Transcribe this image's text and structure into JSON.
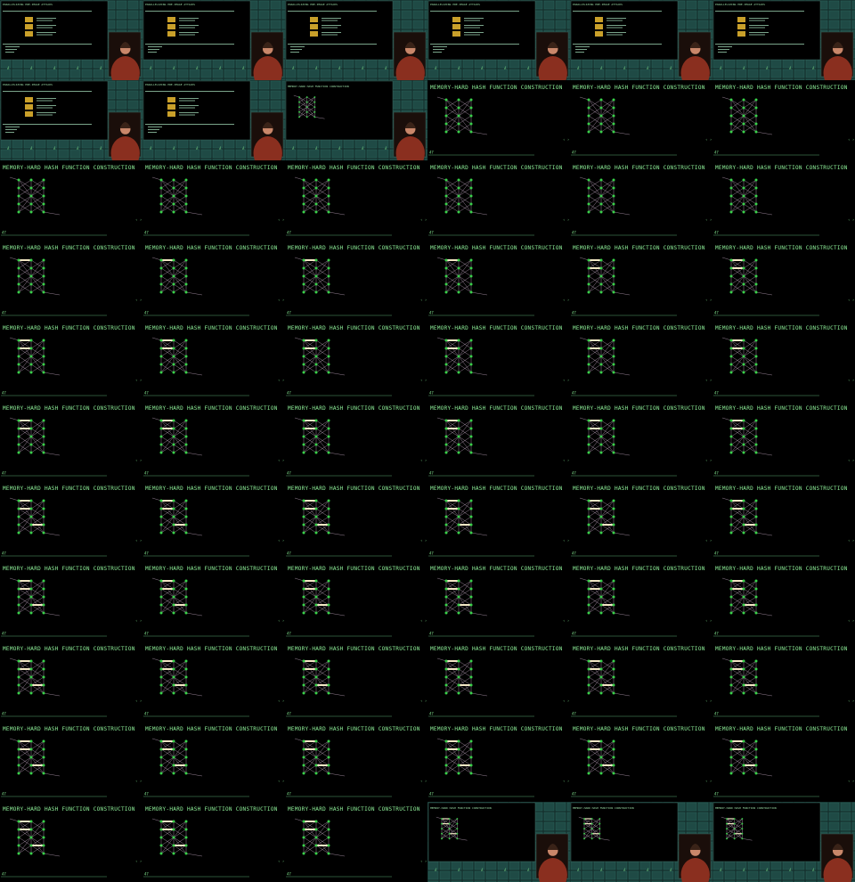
{
  "contact_sheet": {
    "frames": [
      {
        "kind": "talk",
        "title": "PARALLELIZING PRE-IMAGE ATTACKS"
      },
      {
        "kind": "talk",
        "title": "PARALLELIZING PRE-IMAGE ATTACKS"
      },
      {
        "kind": "talk",
        "title": "PARALLELIZING PRE-IMAGE ATTACKS"
      },
      {
        "kind": "talk",
        "title": "PARALLELIZING PRE-IMAGE ATTACKS"
      },
      {
        "kind": "talk",
        "title": "PARALLELIZING PRE-IMAGE ATTACKS"
      },
      {
        "kind": "talk",
        "title": "PARALLELIZING PRE-IMAGE ATTACKS"
      },
      {
        "kind": "talk",
        "title": "PARALLELIZING PRE-IMAGE ATTACKS"
      },
      {
        "kind": "talk",
        "title": "PARALLELIZING PRE-IMAGE ATTACKS"
      },
      {
        "kind": "talkgraph",
        "title": "MEMORY-HARD HASH FUNCTION CONSTRUCTION"
      },
      {
        "kind": "slide",
        "title": "MEMORY-HARD HASH FUNCTION CONSTRUCTION",
        "bars": 0
      },
      {
        "kind": "slide",
        "title": "MEMORY-HARD HASH FUNCTION CONSTRUCTION",
        "bars": 0
      },
      {
        "kind": "slide",
        "title": "MEMORY-HARD HASH FUNCTION CONSTRUCTION",
        "bars": 0
      },
      {
        "kind": "slide",
        "title": "MEMORY-HARD HASH FUNCTION CONSTRUCTION",
        "bars": 0
      },
      {
        "kind": "slide",
        "title": "MEMORY-HARD HASH FUNCTION CONSTRUCTION",
        "bars": 0
      },
      {
        "kind": "slide",
        "title": "MEMORY-HARD HASH FUNCTION CONSTRUCTION",
        "bars": 0
      },
      {
        "kind": "slide",
        "title": "MEMORY-HARD HASH FUNCTION CONSTRUCTION",
        "bars": 0
      },
      {
        "kind": "slide",
        "title": "MEMORY-HARD HASH FUNCTION CONSTRUCTION",
        "bars": 0
      },
      {
        "kind": "slide",
        "title": "MEMORY-HARD HASH FUNCTION CONSTRUCTION",
        "bars": 0
      },
      {
        "kind": "slide",
        "title": "MEMORY-HARD HASH FUNCTION CONSTRUCTION",
        "bars": 1
      },
      {
        "kind": "slide",
        "title": "MEMORY-HARD HASH FUNCTION CONSTRUCTION",
        "bars": 1
      },
      {
        "kind": "slide",
        "title": "MEMORY-HARD HASH FUNCTION CONSTRUCTION",
        "bars": 1
      },
      {
        "kind": "slide",
        "title": "MEMORY-HARD HASH FUNCTION CONSTRUCTION",
        "bars": 1
      },
      {
        "kind": "slide",
        "title": "MEMORY-HARD HASH FUNCTION CONSTRUCTION",
        "bars": 2
      },
      {
        "kind": "slide",
        "title": "MEMORY-HARD HASH FUNCTION CONSTRUCTION",
        "bars": 2
      },
      {
        "kind": "slide",
        "title": "MEMORY-HARD HASH FUNCTION CONSTRUCTION",
        "bars": 2
      },
      {
        "kind": "slide",
        "title": "MEMORY-HARD HASH FUNCTION CONSTRUCTION",
        "bars": 2
      },
      {
        "kind": "slide",
        "title": "MEMORY-HARD HASH FUNCTION CONSTRUCTION",
        "bars": 2
      },
      {
        "kind": "slide",
        "title": "MEMORY-HARD HASH FUNCTION CONSTRUCTION",
        "bars": 2
      },
      {
        "kind": "slide",
        "title": "MEMORY-HARD HASH FUNCTION CONSTRUCTION",
        "bars": 2
      },
      {
        "kind": "slide",
        "title": "MEMORY-HARD HASH FUNCTION CONSTRUCTION",
        "bars": 2
      },
      {
        "kind": "slide",
        "title": "MEMORY-HARD HASH FUNCTION CONSTRUCTION",
        "bars": 2
      },
      {
        "kind": "slide",
        "title": "MEMORY-HARD HASH FUNCTION CONSTRUCTION",
        "bars": 2
      },
      {
        "kind": "slide",
        "title": "MEMORY-HARD HASH FUNCTION CONSTRUCTION",
        "bars": 2
      },
      {
        "kind": "slide",
        "title": "MEMORY-HARD HASH FUNCTION CONSTRUCTION",
        "bars": 2
      },
      {
        "kind": "slide",
        "title": "MEMORY-HARD HASH FUNCTION CONSTRUCTION",
        "bars": 2
      },
      {
        "kind": "slide",
        "title": "MEMORY-HARD HASH FUNCTION CONSTRUCTION",
        "bars": 2
      },
      {
        "kind": "slide",
        "title": "MEMORY-HARD HASH FUNCTION CONSTRUCTION",
        "bars": 3
      },
      {
        "kind": "slide",
        "title": "MEMORY-HARD HASH FUNCTION CONSTRUCTION",
        "bars": 3
      },
      {
        "kind": "slide",
        "title": "MEMORY-HARD HASH FUNCTION CONSTRUCTION",
        "bars": 3
      },
      {
        "kind": "slide",
        "title": "MEMORY-HARD HASH FUNCTION CONSTRUCTION",
        "bars": 3
      },
      {
        "kind": "slide",
        "title": "MEMORY-HARD HASH FUNCTION CONSTRUCTION",
        "bars": 3
      },
      {
        "kind": "slide",
        "title": "MEMORY-HARD HASH FUNCTION CONSTRUCTION",
        "bars": 3
      },
      {
        "kind": "slide",
        "title": "MEMORY-HARD HASH FUNCTION CONSTRUCTION",
        "bars": 3
      },
      {
        "kind": "slide",
        "title": "MEMORY-HARD HASH FUNCTION CONSTRUCTION",
        "bars": 3
      },
      {
        "kind": "slide",
        "title": "MEMORY-HARD HASH FUNCTION CONSTRUCTION",
        "bars": 3
      },
      {
        "kind": "slide",
        "title": "MEMORY-HARD HASH FUNCTION CONSTRUCTION",
        "bars": 3
      },
      {
        "kind": "slide",
        "title": "MEMORY-HARD HASH FUNCTION CONSTRUCTION",
        "bars": 3
      },
      {
        "kind": "slide",
        "title": "MEMORY-HARD HASH FUNCTION CONSTRUCTION",
        "bars": 3
      },
      {
        "kind": "slide",
        "title": "MEMORY-HARD HASH FUNCTION CONSTRUCTION",
        "bars": 3
      },
      {
        "kind": "slide",
        "title": "MEMORY-HARD HASH FUNCTION CONSTRUCTION",
        "bars": 3
      },
      {
        "kind": "slide",
        "title": "MEMORY-HARD HASH FUNCTION CONSTRUCTION",
        "bars": 3
      },
      {
        "kind": "slide",
        "title": "MEMORY-HARD HASH FUNCTION CONSTRUCTION",
        "bars": 3
      },
      {
        "kind": "slide",
        "title": "MEMORY-HARD HASH FUNCTION CONSTRUCTION",
        "bars": 3
      },
      {
        "kind": "slide",
        "title": "MEMORY-HARD HASH FUNCTION CONSTRUCTION",
        "bars": 3
      },
      {
        "kind": "slide",
        "title": "MEMORY-HARD HASH FUNCTION CONSTRUCTION",
        "bars": 3
      },
      {
        "kind": "slide",
        "title": "MEMORY-HARD HASH FUNCTION CONSTRUCTION",
        "bars": 3
      },
      {
        "kind": "slide",
        "title": "MEMORY-HARD HASH FUNCTION CONSTRUCTION",
        "bars": 3
      },
      {
        "kind": "slide",
        "title": "MEMORY-HARD HASH FUNCTION CONSTRUCTION",
        "bars": 3
      },
      {
        "kind": "slide",
        "title": "MEMORY-HARD HASH FUNCTION CONSTRUCTION",
        "bars": 3
      },
      {
        "kind": "slide",
        "title": "MEMORY-HARD HASH FUNCTION CONSTRUCTION",
        "bars": 3
      },
      {
        "kind": "slide",
        "title": "MEMORY-HARD HASH FUNCTION CONSTRUCTION",
        "bars": 3
      },
      {
        "kind": "slide",
        "title": "MEMORY-HARD HASH FUNCTION CONSTRUCTION",
        "bars": 3
      },
      {
        "kind": "slide",
        "title": "MEMORY-HARD HASH FUNCTION CONSTRUCTION",
        "bars": 3
      },
      {
        "kind": "talkgraph",
        "title": "MEMORY-HARD HASH FUNCTION CONSTRUCTION"
      },
      {
        "kind": "talkgraph",
        "title": "MEMORY-HARD HASH FUNCTION CONSTRUCTION"
      },
      {
        "kind": "talkgraph",
        "title": "MEMORY-HARD HASH FUNCTION CONSTRUCTION"
      }
    ],
    "slide_number": "47",
    "colors": {
      "accent_green": "#8ff29a",
      "node_green": "#39d24a",
      "bar_cream": "#f3e6c5",
      "teal_bg": "#16322f",
      "speaker_red": "#8a2f1f"
    }
  }
}
